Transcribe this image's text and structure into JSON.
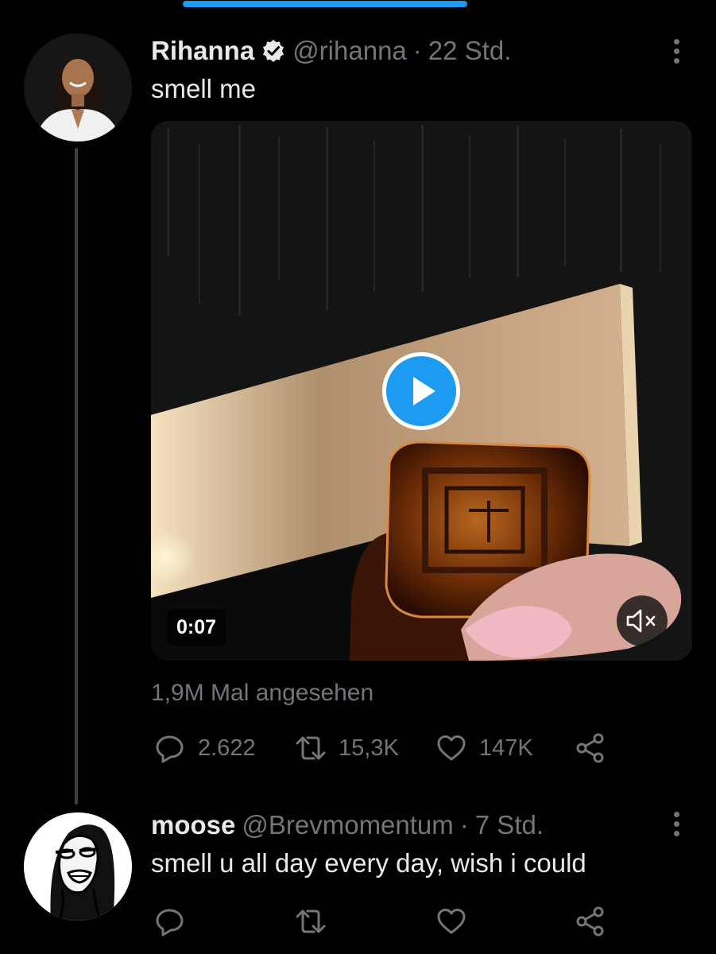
{
  "colors": {
    "background": "#000000",
    "text_primary": "#e7e9ea",
    "text_secondary": "#71767b",
    "accent": "#1d9bf0"
  },
  "progress": {
    "fill_fraction": 0.4
  },
  "main_tweet": {
    "author_name": "Rihanna",
    "handle": "@rihanna",
    "separator": "·",
    "time": "22 Std.",
    "text": "smell me",
    "video": {
      "duration": "0:07",
      "play_icon": "play-icon",
      "mute_icon": "volume-muted-icon"
    },
    "views": "1,9M Mal angesehen",
    "actions": {
      "reply_count": "2.622",
      "retweet_count": "15,3K",
      "like_count": "147K"
    }
  },
  "reply_tweet": {
    "author_name": "moose",
    "handle": "@Brevmomentum",
    "separator": "·",
    "time": "7 Std.",
    "text": "smell u all day every day, wish i could"
  }
}
